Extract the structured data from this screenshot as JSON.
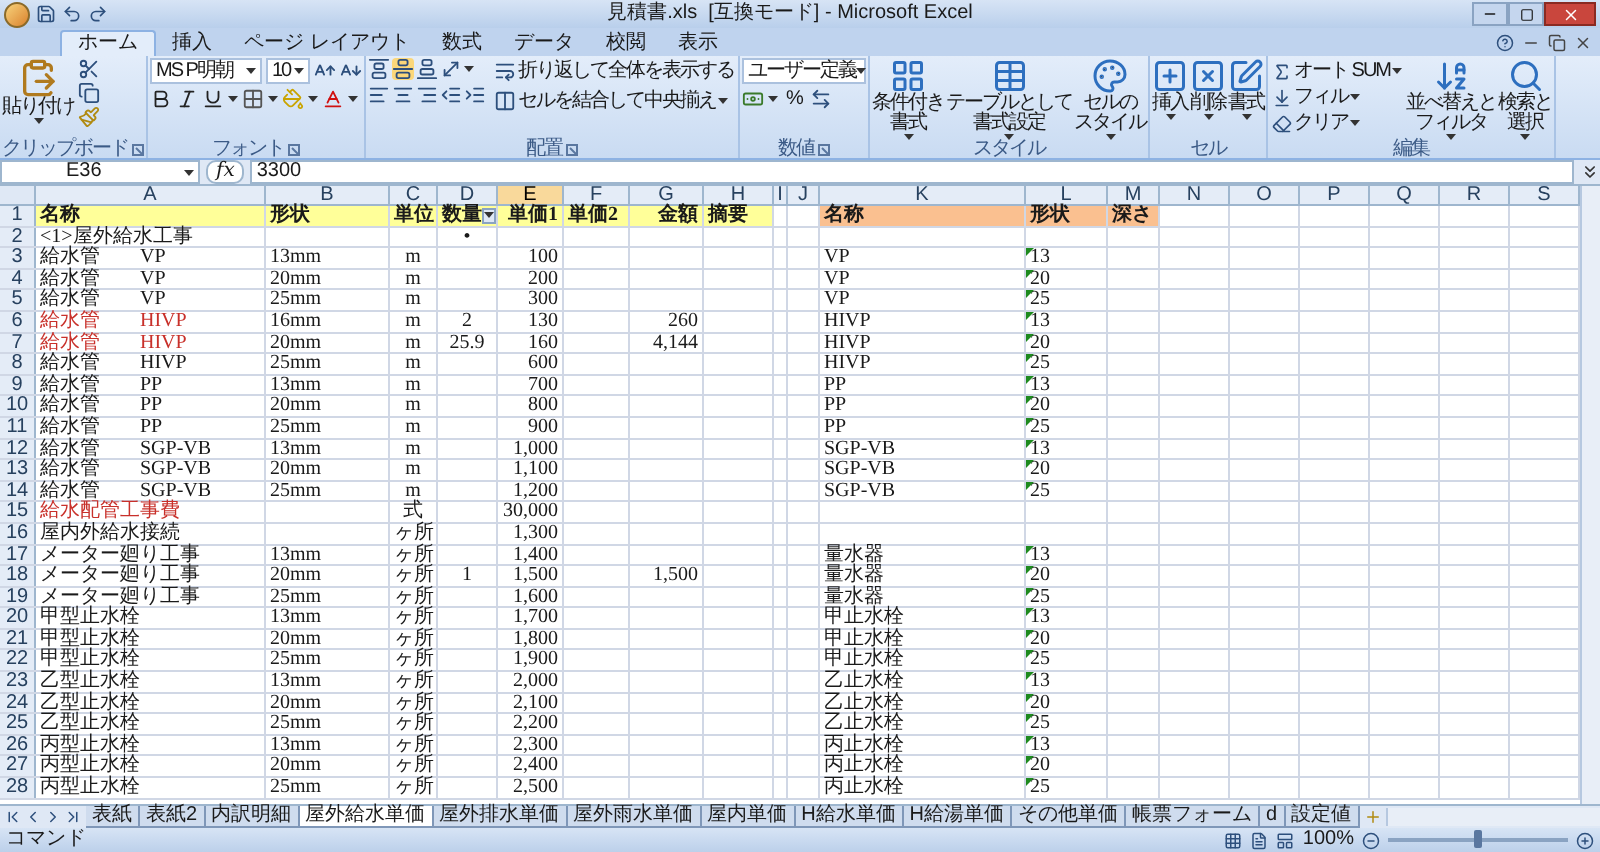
{
  "window": {
    "title": "見積書.xls  [互換モード] - Microsoft Excel"
  },
  "tabs": [
    {
      "label": "ホーム",
      "selected": true
    },
    {
      "label": "挿入",
      "selected": false
    },
    {
      "label": "ページ レイアウト",
      "selected": false
    },
    {
      "label": "数式",
      "selected": false
    },
    {
      "label": "データ",
      "selected": false
    },
    {
      "label": "校閲",
      "selected": false
    },
    {
      "label": "表示",
      "selected": false
    }
  ],
  "ribbon": {
    "groups": [
      {
        "kind": "clipboard",
        "label": "クリップボード",
        "launcher": true,
        "buttons": [
          {
            "lines": [
              "貼り付け"
            ]
          }
        ]
      },
      {
        "kind": "font",
        "label": "フォント",
        "launcher": true,
        "font": "MS P明朝",
        "size": "10"
      },
      {
        "kind": "alignment",
        "label": "配置",
        "launcher": true,
        "middle_aligned": true,
        "buttons": [
          {
            "lines": [
              "折り返して全体を表示する"
            ]
          },
          {
            "lines": [
              "セルを結合して中央揃え"
            ]
          }
        ]
      },
      {
        "kind": "number",
        "label": "数値",
        "launcher": true,
        "format": "ユーザー定義",
        "buttons": [
          {
            "lines": [
              "%"
            ]
          }
        ]
      },
      {
        "kind": "styles",
        "label": "スタイル",
        "launcher": false,
        "buttons": [
          {
            "lines": [
              "条件付き",
              "書式"
            ]
          },
          {
            "lines": [
              "テーブルとして",
              "書式設定"
            ]
          },
          {
            "lines": [
              "セルの",
              "スタイル"
            ]
          }
        ]
      },
      {
        "kind": "cells",
        "label": "セル",
        "launcher": false,
        "buttons": [
          {
            "lines": [
              "挿入"
            ]
          },
          {
            "lines": [
              "削除"
            ]
          },
          {
            "lines": [
              "書式"
            ]
          }
        ]
      },
      {
        "kind": "editing",
        "label": "編集",
        "launcher": false,
        "small": [
          "オート SUM",
          "フィル",
          "クリア"
        ],
        "buttons": [
          {
            "lines": [
              "並べ替えと",
              "フィルタ"
            ]
          },
          {
            "lines": [
              "検索と",
              "選択"
            ]
          }
        ]
      }
    ]
  },
  "formula_bar": {
    "cell": "E36",
    "function_label": "fx",
    "value": "3300"
  },
  "columns": [
    {
      "label": "A",
      "selected": false
    },
    {
      "label": "B",
      "selected": false
    },
    {
      "label": "C",
      "selected": false
    },
    {
      "label": "D",
      "selected": false
    },
    {
      "label": "E",
      "selected": true
    },
    {
      "label": "F",
      "selected": false
    },
    {
      "label": "G",
      "selected": false
    },
    {
      "label": "H",
      "selected": false
    },
    {
      "label": "I",
      "selected": false
    },
    {
      "label": "J",
      "selected": false
    },
    {
      "label": "K",
      "selected": false
    },
    {
      "label": "L",
      "selected": false
    },
    {
      "label": "M",
      "selected": false
    },
    {
      "label": "N",
      "selected": false
    },
    {
      "label": "O",
      "selected": false
    },
    {
      "label": "P",
      "selected": false
    },
    {
      "label": "Q",
      "selected": false
    },
    {
      "label": "R",
      "selected": false
    },
    {
      "label": "S",
      "selected": false
    }
  ],
  "rows": [
    {
      "n": "1",
      "kind": "header",
      "filter": true,
      "cells": {
        "a": "名称",
        "b": "形状",
        "c": "単位",
        "d": "数量",
        "e": "単価1",
        "f": "単価2",
        "g": "金額",
        "h": "摘要",
        "k": "名称",
        "l": "形状",
        "m": "深さ"
      }
    },
    {
      "n": "2",
      "cells": {
        "a": "<1>屋外給水工事",
        "d": "•"
      }
    },
    {
      "n": "3",
      "cells": {
        "a": "給水管　　VP",
        "b": "13mm",
        "c": "m",
        "e": "100",
        "k": "VP",
        "l": "13"
      },
      "l_mark": true
    },
    {
      "n": "4",
      "cells": {
        "a": "給水管　　VP",
        "b": "20mm",
        "c": "m",
        "e": "200",
        "k": "VP",
        "l": "20"
      },
      "l_mark": true
    },
    {
      "n": "5",
      "cells": {
        "a": "給水管　　VP",
        "b": "25mm",
        "c": "m",
        "e": "300",
        "k": "VP",
        "l": "25"
      },
      "l_mark": true
    },
    {
      "n": "6",
      "emphasis": true,
      "cells": {
        "a": "給水管　　HIVP",
        "b": "16mm",
        "c": "m",
        "d": "2",
        "e": "130",
        "g": "260",
        "k": "HIVP",
        "l": "13"
      },
      "l_mark": true
    },
    {
      "n": "7",
      "emphasis": true,
      "cells": {
        "a": "給水管　　HIVP",
        "b": "20mm",
        "c": "m",
        "d": "25.9",
        "e": "160",
        "g": "4,144",
        "k": "HIVP",
        "l": "20"
      },
      "l_mark": true
    },
    {
      "n": "8",
      "cells": {
        "a": "給水管　　HIVP",
        "b": "25mm",
        "c": "m",
        "e": "600",
        "k": "HIVP",
        "l": "25"
      },
      "l_mark": true
    },
    {
      "n": "9",
      "cells": {
        "a": "給水管　　PP",
        "b": "13mm",
        "c": "m",
        "e": "700",
        "k": "PP",
        "l": "13"
      },
      "l_mark": true
    },
    {
      "n": "10",
      "cells": {
        "a": "給水管　　PP",
        "b": "20mm",
        "c": "m",
        "e": "800",
        "k": "PP",
        "l": "20"
      },
      "l_mark": true
    },
    {
      "n": "11",
      "cells": {
        "a": "給水管　　PP",
        "b": "25mm",
        "c": "m",
        "e": "900",
        "k": "PP",
        "l": "25"
      },
      "l_mark": true
    },
    {
      "n": "12",
      "cells": {
        "a": "給水管　　SGP-VB",
        "b": "13mm",
        "c": "m",
        "e": "1,000",
        "k": "SGP-VB",
        "l": "13"
      },
      "l_mark": true
    },
    {
      "n": "13",
      "cells": {
        "a": "給水管　　SGP-VB",
        "b": "20mm",
        "c": "m",
        "e": "1,100",
        "k": "SGP-VB",
        "l": "20"
      },
      "l_mark": true
    },
    {
      "n": "14",
      "cells": {
        "a": "給水管　　SGP-VB",
        "b": "25mm",
        "c": "m",
        "e": "1,200",
        "k": "SGP-VB",
        "l": "25"
      },
      "l_mark": true
    },
    {
      "n": "15",
      "emphasis": true,
      "cells": {
        "a": "給水配管工事費",
        "c": "式",
        "e": "30,000"
      }
    },
    {
      "n": "16",
      "cells": {
        "a": "屋内外給水接続",
        "c": "ヶ所",
        "e": "1,300"
      }
    },
    {
      "n": "17",
      "cells": {
        "a": "メーター廻り工事",
        "b": "13mm",
        "c": "ヶ所",
        "e": "1,400",
        "k": "量水器",
        "l": "13"
      },
      "l_mark": true
    },
    {
      "n": "18",
      "cells": {
        "a": "メーター廻り工事",
        "b": "20mm",
        "c": "ヶ所",
        "d": "1",
        "e": "1,500",
        "g": "1,500",
        "k": "量水器",
        "l": "20"
      },
      "l_mark": true
    },
    {
      "n": "19",
      "cells": {
        "a": "メーター廻り工事",
        "b": "25mm",
        "c": "ヶ所",
        "e": "1,600",
        "k": "量水器",
        "l": "25"
      },
      "l_mark": true
    },
    {
      "n": "20",
      "cells": {
        "a": "甲型止水栓",
        "b": "13mm",
        "c": "ヶ所",
        "e": "1,700",
        "k": "甲止水栓",
        "l": "13"
      },
      "l_mark": true
    },
    {
      "n": "21",
      "cells": {
        "a": "甲型止水栓",
        "b": "20mm",
        "c": "ヶ所",
        "e": "1,800",
        "k": "甲止水栓",
        "l": "20"
      },
      "l_mark": true
    },
    {
      "n": "22",
      "cells": {
        "a": "甲型止水栓",
        "b": "25mm",
        "c": "ヶ所",
        "e": "1,900",
        "k": "甲止水栓",
        "l": "25"
      },
      "l_mark": true
    },
    {
      "n": "23",
      "cells": {
        "a": "乙型止水栓",
        "b": "13mm",
        "c": "ヶ所",
        "e": "2,000",
        "k": "乙止水栓",
        "l": "13"
      },
      "l_mark": true
    },
    {
      "n": "24",
      "cells": {
        "a": "乙型止水栓",
        "b": "20mm",
        "c": "ヶ所",
        "e": "2,100",
        "k": "乙止水栓",
        "l": "20"
      },
      "l_mark": true
    },
    {
      "n": "25",
      "cells": {
        "a": "乙型止水栓",
        "b": "25mm",
        "c": "ヶ所",
        "e": "2,200",
        "k": "乙止水栓",
        "l": "25"
      },
      "l_mark": true
    },
    {
      "n": "26",
      "cells": {
        "a": "丙型止水栓",
        "b": "13mm",
        "c": "ヶ所",
        "e": "2,300",
        "k": "丙止水栓",
        "l": "13"
      },
      "l_mark": true
    },
    {
      "n": "27",
      "cells": {
        "a": "丙型止水栓",
        "b": "20mm",
        "c": "ヶ所",
        "e": "2,400",
        "k": "丙止水栓",
        "l": "20"
      },
      "l_mark": true
    },
    {
      "n": "28",
      "cells": {
        "a": "丙型止水栓",
        "b": "25mm",
        "c": "ヶ所",
        "e": "2,500",
        "k": "丙止水栓",
        "l": "25"
      },
      "l_mark": true
    }
  ],
  "sheet_tabs": [
    {
      "label": "表紙",
      "selected": false
    },
    {
      "label": "表紙2",
      "selected": false
    },
    {
      "label": "内訳明細",
      "selected": false
    },
    {
      "label": "屋外給水単価",
      "selected": true
    },
    {
      "label": "屋外排水単価",
      "selected": false
    },
    {
      "label": "屋外雨水単価",
      "selected": false
    },
    {
      "label": "屋内単価",
      "selected": false
    },
    {
      "label": "H給水単価",
      "selected": false
    },
    {
      "label": "H給湯単価",
      "selected": false
    },
    {
      "label": "その他単価",
      "selected": false
    },
    {
      "label": "帳票フォーム",
      "selected": false
    },
    {
      "label": "d",
      "selected": false
    },
    {
      "label": "設定値",
      "selected": false
    }
  ],
  "status_bar": {
    "mode": "コマンド",
    "zoom": {
      "label": "100%",
      "level": 0.5
    }
  }
}
